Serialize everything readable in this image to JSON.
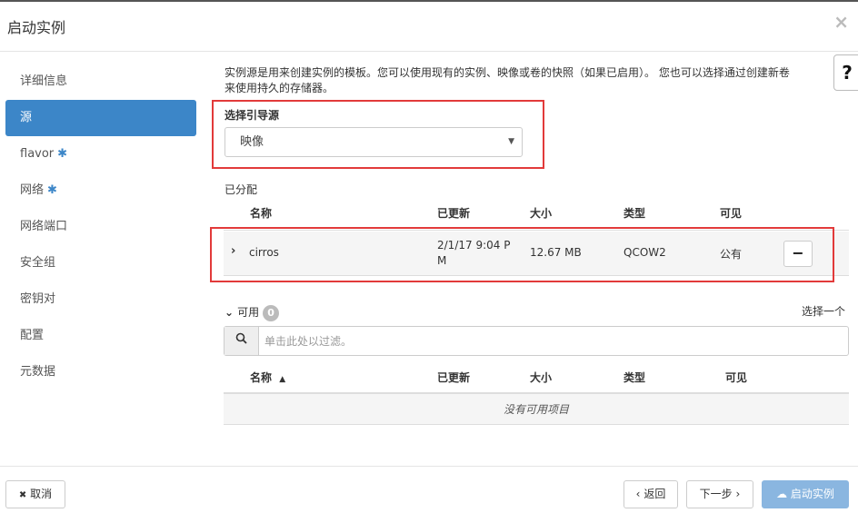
{
  "header": {
    "title": "启动实例",
    "close_glyph": "×"
  },
  "sidebar": {
    "items": [
      {
        "label": "详细信息",
        "required": false,
        "active": false
      },
      {
        "label": "源",
        "required": false,
        "active": true
      },
      {
        "label": "flavor",
        "required": true,
        "active": false
      },
      {
        "label": "网络",
        "required": true,
        "active": false
      },
      {
        "label": "网络端口",
        "required": false,
        "active": false
      },
      {
        "label": "安全组",
        "required": false,
        "active": false
      },
      {
        "label": "密钥对",
        "required": false,
        "active": false
      },
      {
        "label": "配置",
        "required": false,
        "active": false
      },
      {
        "label": "元数据",
        "required": false,
        "active": false
      }
    ],
    "required_glyph": "✱"
  },
  "help": {
    "glyph": "?"
  },
  "description": {
    "line1": "实例源是用来创建实例的模板。您可以使用现有的实例、映像或卷的快照（如果已启用）。 您也可以选择通过创建新卷",
    "line2": "来使用持久的存储器。"
  },
  "boot_source": {
    "label": "选择引导源",
    "value": "映像",
    "caret": "▼"
  },
  "allocated": {
    "label": "已分配",
    "headers": [
      "名称",
      "已更新",
      "大小",
      "类型",
      "可见"
    ],
    "rows": [
      {
        "name": "cirros",
        "updated_line1": "2/1/17 9:04 P",
        "updated_line2": "M",
        "size": "12.67 MB",
        "type": "QCOW2",
        "visibility": "公有",
        "expand_glyph": "›",
        "remove_glyph": "−"
      }
    ]
  },
  "available": {
    "label": "可用",
    "count": "0",
    "chevron": "⌄",
    "select_one": "选择一个",
    "filter_placeholder": "单击此处以过滤。",
    "headers": [
      "名称",
      "已更新",
      "大小",
      "类型",
      "可见"
    ],
    "sort_glyph": "▲",
    "empty_text": "没有可用项目"
  },
  "footer": {
    "cancel": "取消",
    "cancel_glyph": "✖",
    "back": "返回",
    "back_glyph": "‹",
    "next": "下一步",
    "next_glyph": "›",
    "launch": "启动实例",
    "launch_glyph": "☁"
  },
  "colors": {
    "accent": "#3c86c8",
    "highlight_box": "#e23a3a",
    "launch_button": "#8ab6e0"
  }
}
